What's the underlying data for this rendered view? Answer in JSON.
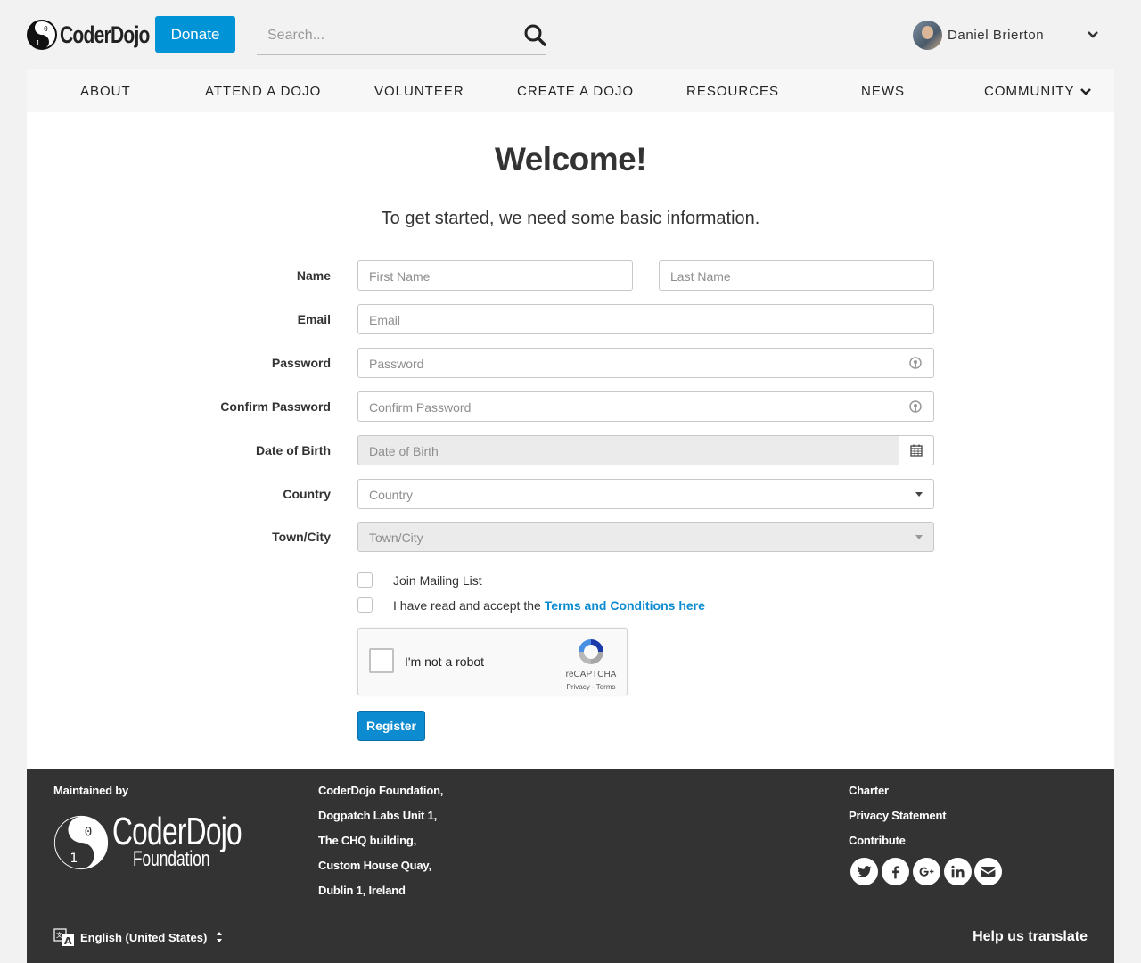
{
  "header": {
    "logo_text": "CoderDojo",
    "donate_label": "Donate",
    "search_placeholder": "Search...",
    "user_name": "Daniel Brierton"
  },
  "nav": {
    "items": [
      "ABOUT",
      "ATTEND A DOJO",
      "VOLUNTEER",
      "CREATE A DOJO",
      "RESOURCES",
      "NEWS",
      "COMMUNITY"
    ]
  },
  "form": {
    "title": "Welcome!",
    "subtitle": "To get started, we need some basic information.",
    "labels": {
      "name": "Name",
      "email": "Email",
      "password": "Password",
      "confirm_password": "Confirm Password",
      "dob": "Date of Birth",
      "country": "Country",
      "town": "Town/City"
    },
    "placeholders": {
      "first_name": "First Name",
      "last_name": "Last Name",
      "email": "Email",
      "password": "Password",
      "confirm_password": "Confirm Password",
      "dob": "Date of Birth",
      "country": "Country",
      "town": "Town/City"
    },
    "mailing_list_label": "Join Mailing List",
    "terms_prefix": "I have read and accept the ",
    "terms_link": "Terms and Conditions here",
    "recaptcha": {
      "label": "I'm not a robot",
      "brand": "reCAPTCHA",
      "terms": "Privacy - Terms"
    },
    "register_label": "Register"
  },
  "footer": {
    "maintained_by": "Maintained by",
    "logo_name": "CoderDojo",
    "logo_sub": "Foundation",
    "address": [
      "CoderDojo Foundation,",
      "Dogpatch Labs Unit 1,",
      "The CHQ building,",
      "Custom House Quay,",
      "Dublin 1, Ireland"
    ],
    "links": [
      "Charter",
      "Privacy Statement",
      "Contribute"
    ],
    "social": [
      "twitter-icon",
      "facebook-icon",
      "google-plus-icon",
      "linkedin-icon",
      "email-icon"
    ],
    "language": "English (United States)",
    "help_translate": "Help us translate"
  },
  "colors": {
    "accent": "#0093d5",
    "footer_bg": "#333333",
    "page_bg": "#f2f2f2"
  }
}
